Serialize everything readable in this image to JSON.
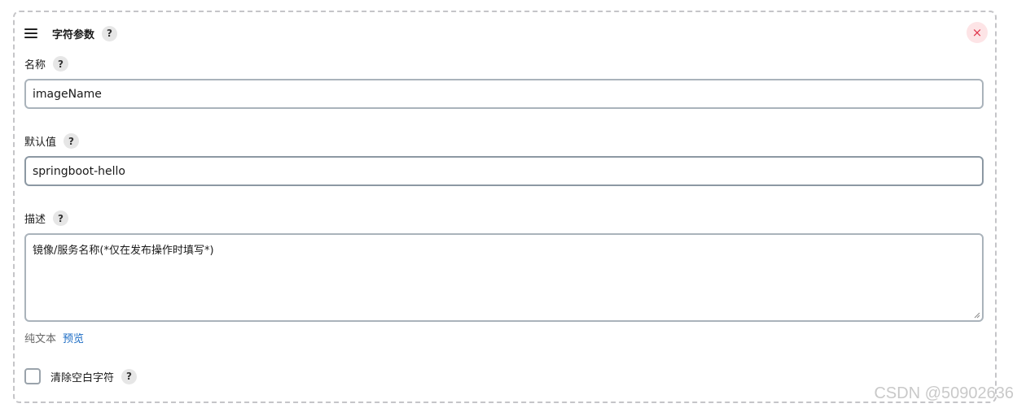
{
  "header": {
    "title": "字符参数",
    "help": "?",
    "close": "×"
  },
  "name": {
    "label": "名称",
    "help": "?",
    "value": "imageName"
  },
  "default_value": {
    "label": "默认值",
    "help": "?",
    "value": "springboot-hello"
  },
  "description": {
    "label": "描述",
    "help": "?",
    "value": "镜像/服务名称(*仅在发布操作时填写*)",
    "plain_text": "纯文本",
    "preview": "预览"
  },
  "trim": {
    "label": "清除空白字符",
    "help": "?"
  },
  "watermark": "CSDN @50902636",
  "icons": {
    "drag": "hamburger-icon",
    "close": "close-icon",
    "help": "help-icon"
  },
  "colors": {
    "close_bg": "#fde4e6",
    "close_fg": "#e0354b",
    "link": "#1a6bc4"
  }
}
